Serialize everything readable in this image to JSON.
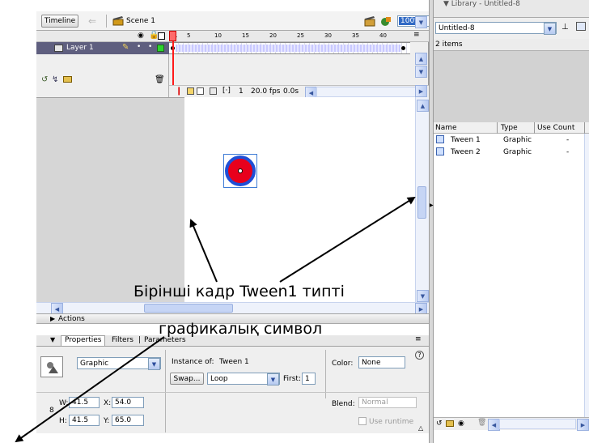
{
  "timeline": {
    "tab_label": "Timeline",
    "scene_label": "Scene 1",
    "zoom_value": "100%",
    "frame_ticks": [
      "1",
      "5",
      "10",
      "15",
      "20",
      "25",
      "30",
      "35",
      "40"
    ],
    "layer_name": "Layer 1",
    "current_frame": "1",
    "fps": "20.0 fps",
    "elapsed": "0.0s"
  },
  "library": {
    "panel_title": "▼ Library - Untitled-8",
    "doc_select": "Untitled-8",
    "item_count": "2 items",
    "columns": [
      "Name",
      "Type",
      "Use Count"
    ],
    "items": [
      {
        "name": "Tween 1",
        "type": "Graphic",
        "count": "-"
      },
      {
        "name": "Tween 2",
        "type": "Graphic",
        "count": "-"
      }
    ]
  },
  "actions": {
    "label": "Actions"
  },
  "properties": {
    "tabs": [
      "Properties",
      "Filters",
      "Parameters"
    ],
    "symbol_type": "Graphic",
    "instance_of_label": "Instance of:",
    "instance_of_value": "Tween 1",
    "color_label": "Color:",
    "color_value": "None",
    "swap_label": "Swap...",
    "loop_value": "Loop",
    "first_label": "First:",
    "first_value": "1",
    "w_label": "W:",
    "w_value": "41.5",
    "h_label": "H:",
    "h_value": "41.5",
    "x_label": "X:",
    "x_value": "54.0",
    "y_label": "Y:",
    "y_value": "65.0",
    "blend_label": "Blend:",
    "blend_value": "Normal",
    "use_runtime_label": "Use runtime",
    "lock_number": "8"
  },
  "annotation": {
    "line1": "Бірінші кадр Tween1 типті",
    "line2": "графикалық символ"
  },
  "colors": {
    "circle_fill": "#e8001c",
    "circle_stroke": "#1f4fd6",
    "selection_box": "#3e7cd6"
  }
}
